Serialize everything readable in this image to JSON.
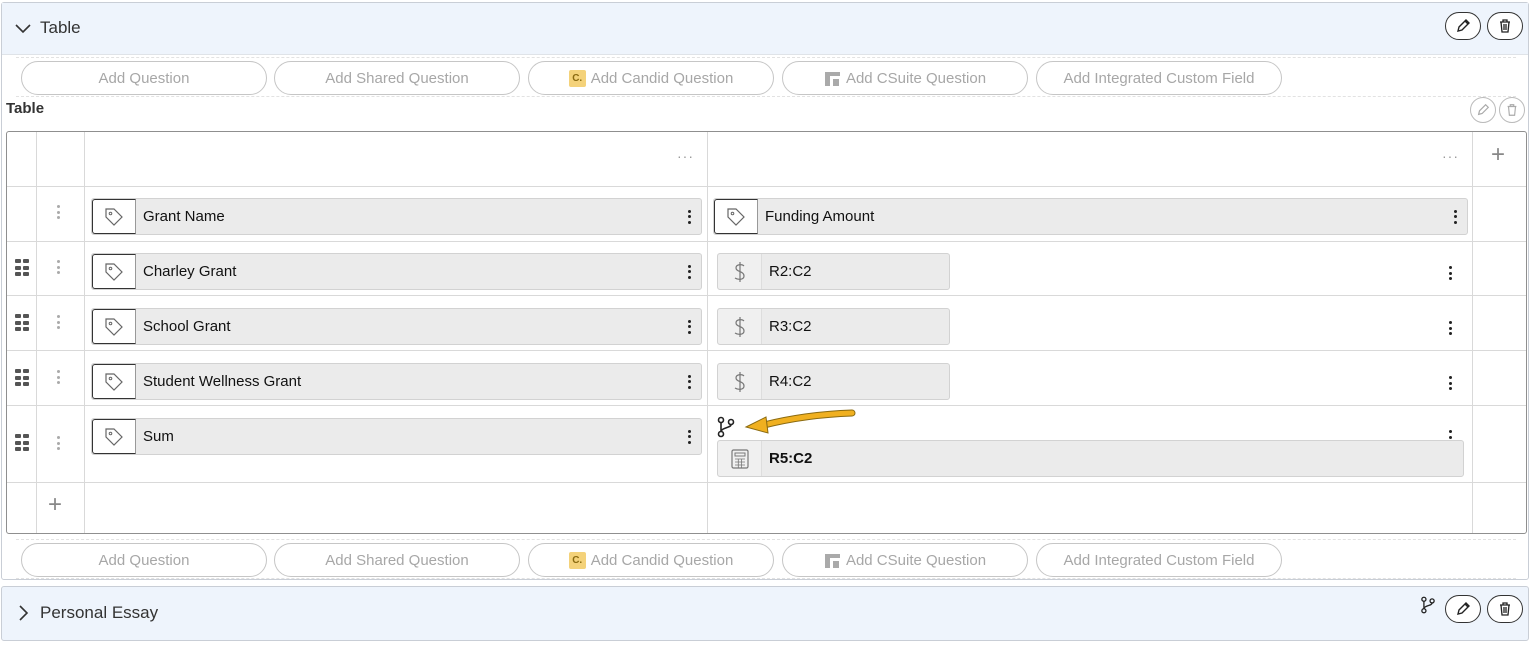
{
  "table_section": {
    "title": "Table",
    "edit_icon": "pencil-icon",
    "delete_icon": "trash-icon"
  },
  "add_buttons": {
    "add_question": "Add Question",
    "add_shared_question": "Add Shared Question",
    "add_candid_question": "Add Candid Question",
    "candid_badge": "C.",
    "add_csuite_question": "Add CSuite Question",
    "add_integrated_custom_field": "Add Integrated Custom Field"
  },
  "table": {
    "label": "Table",
    "header_row": {
      "col1": "Grant Name",
      "col2": "Funding Amount"
    },
    "rows": [
      {
        "label": "Charley Grant",
        "value": "R2:C2",
        "value_icon": "dollar-icon"
      },
      {
        "label": "School Grant",
        "value": "R3:C2",
        "value_icon": "dollar-icon"
      },
      {
        "label": "Student Wellness Grant",
        "value": "R4:C2",
        "value_icon": "dollar-icon"
      },
      {
        "label": "Sum",
        "value": "R5:C2",
        "value_icon": "calculator-icon"
      }
    ],
    "column_menu": "···",
    "add_column": "+",
    "add_row": "+"
  },
  "essay_section": {
    "title": "Personal Essay"
  },
  "colors": {
    "header_bg": "#eef4fc",
    "annotation_arrow": "#f0b020"
  }
}
